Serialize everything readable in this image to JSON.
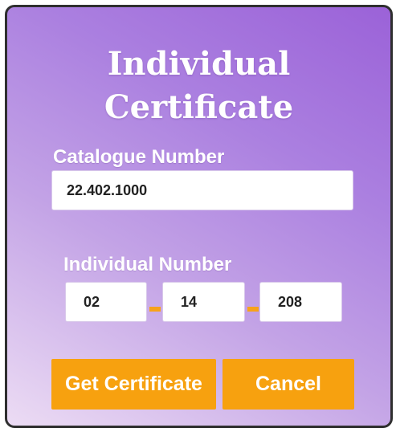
{
  "dialog": {
    "title_line1": "Individual",
    "title_line2": "Certificate",
    "catalogue_label": "Catalogue Number",
    "catalogue_value": "22.402.1000",
    "individual_label": "Individual Number",
    "individual_segments": [
      "02",
      "14",
      "208"
    ],
    "get_certificate_label": "Get Certificate",
    "cancel_label": "Cancel"
  },
  "colors": {
    "accent": "#f7a10f",
    "gradient_light": "#ecdcf4",
    "gradient_dark": "#9b62d8",
    "border": "#2f2f2f",
    "text_on_dialog": "#ffffff"
  }
}
